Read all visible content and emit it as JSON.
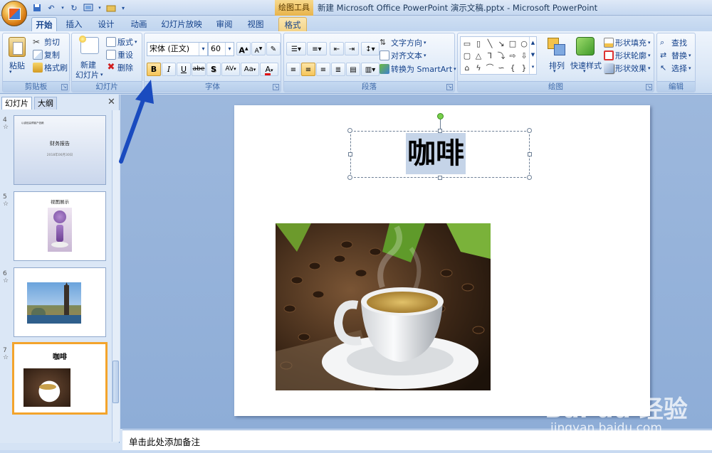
{
  "window": {
    "contextual_tab_group": "绘图工具",
    "title": "新建 Microsoft Office PowerPoint 演示文稿.pptx - Microsoft PowerPoint"
  },
  "tabs": [
    {
      "label": "开始",
      "active": true
    },
    {
      "label": "插入"
    },
    {
      "label": "设计"
    },
    {
      "label": "动画"
    },
    {
      "label": "幻灯片放映"
    },
    {
      "label": "审阅"
    },
    {
      "label": "视图"
    },
    {
      "label": "格式"
    }
  ],
  "ribbon": {
    "clipboard": {
      "label": "剪贴板",
      "paste": "粘贴",
      "cut": "剪切",
      "copy": "复制",
      "format_painter": "格式刷"
    },
    "slides": {
      "label": "幻灯片",
      "new_slide_line1": "新建",
      "new_slide_line2": "幻灯片",
      "layout": "版式",
      "reset": "重设",
      "delete": "删除"
    },
    "font": {
      "label": "字体",
      "font_name": "宋体 (正文)",
      "font_size": "60",
      "bold": "B",
      "italic": "I",
      "underline": "U",
      "strike": "abe",
      "shadow": "S",
      "spacing": "AV",
      "case": "Aa",
      "color": "A",
      "grow": "A",
      "shrink": "A"
    },
    "paragraph": {
      "label": "段落",
      "text_direction": "文字方向",
      "align_text": "对齐文本",
      "convert_smartart": "转换为 SmartArt"
    },
    "drawing": {
      "label": "绘图",
      "arrange": "排列",
      "quick_styles": "快速样式",
      "shape_fill": "形状填充",
      "shape_outline": "形状轮廓",
      "shape_effects": "形状效果"
    },
    "editing": {
      "label": "编辑",
      "find": "查找",
      "replace": "替换",
      "select": "选择"
    }
  },
  "left_pane": {
    "tab_slides": "幻灯片",
    "tab_outline": "大纲",
    "close": "✕",
    "thumbnails": [
      {
        "number": "4",
        "title": "财务报告",
        "subtitle": "2018年06月30日",
        "header": "以诚信赢得客户信赖"
      },
      {
        "number": "5",
        "title": "视图展示"
      },
      {
        "number": "6"
      },
      {
        "number": "7",
        "title": "咖啡",
        "selected": true
      }
    ]
  },
  "slide": {
    "title": "咖啡"
  },
  "notes": {
    "placeholder": "单击此处添加备注"
  },
  "watermark": {
    "text": "Bai du 经验",
    "url": "jingyan.baidu.com"
  },
  "colors": {
    "accent_arrow": "#1a4bbf",
    "selection_border": "#f3a42c",
    "ribbon_text": "#15428b"
  }
}
